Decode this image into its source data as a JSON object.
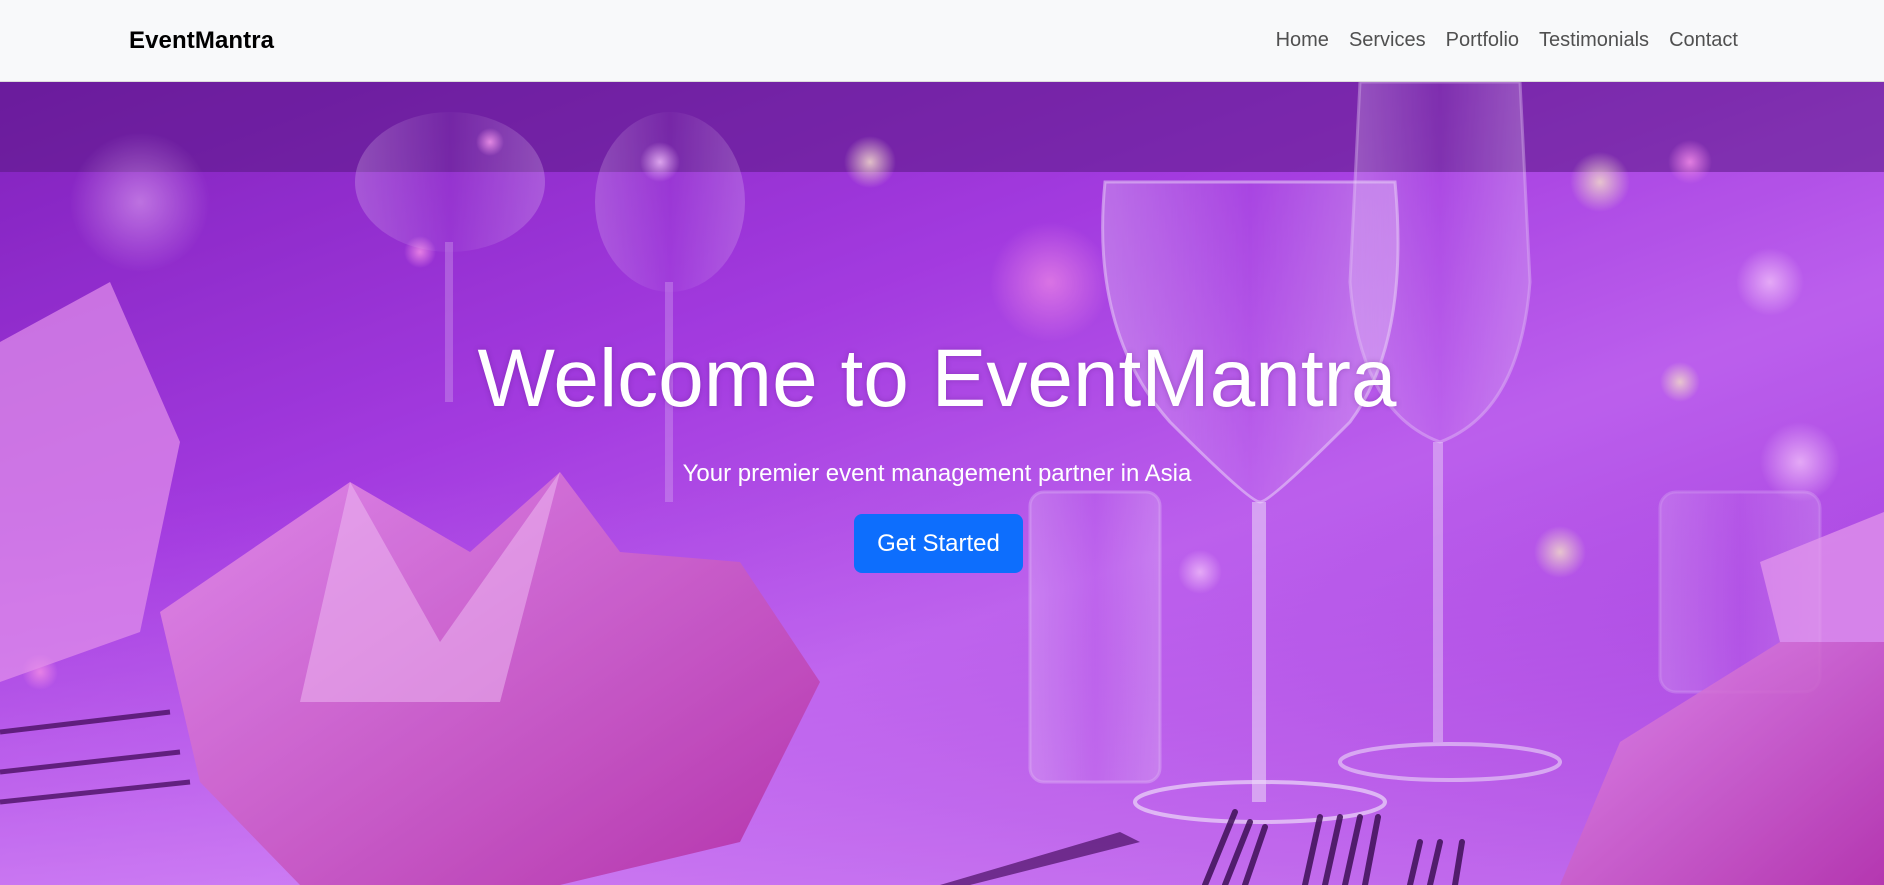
{
  "navbar": {
    "brand": "EventMantra",
    "links": [
      "Home",
      "Services",
      "Portfolio",
      "Testimonials",
      "Contact"
    ]
  },
  "hero": {
    "title": "Welcome to EventMantra",
    "subtitle": "Your premier event management partner in Asia",
    "cta_label": "Get Started"
  },
  "colors": {
    "navbar_bg": "#f8f9fa",
    "cta_bg": "#0d6efd",
    "hero_tint": "#a53ee0"
  }
}
